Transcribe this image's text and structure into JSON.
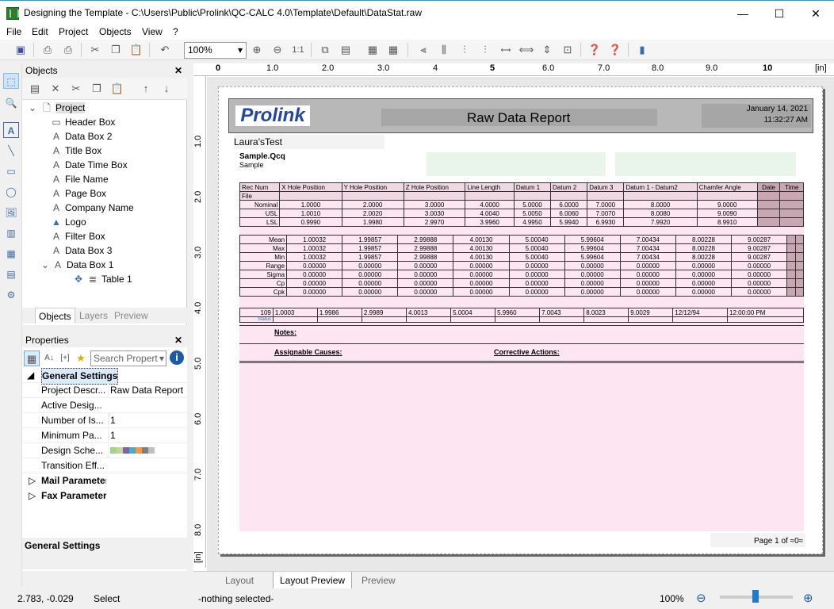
{
  "window": {
    "title": "Designing the Template - C:\\Users\\Public\\Prolink\\QC-CALC 4.0\\Template\\Default\\DataStat.raw"
  },
  "menu": [
    "File",
    "Edit",
    "Project",
    "Objects",
    "View",
    "?"
  ],
  "toolbar": {
    "zoom_value": "100%"
  },
  "objects_panel": {
    "title": "Objects",
    "tree": [
      {
        "label": "Project",
        "icon": "page-icon",
        "level": 0
      },
      {
        "label": "Header Box",
        "icon": "rect-icon",
        "level": 1
      },
      {
        "label": "Data Box 2",
        "icon": "text-icon",
        "level": 1
      },
      {
        "label": "Title Box",
        "icon": "text-icon",
        "level": 1
      },
      {
        "label": "Date Time Box",
        "icon": "text-icon",
        "level": 1
      },
      {
        "label": "File Name",
        "icon": "text-icon",
        "level": 1
      },
      {
        "label": "Page Box",
        "icon": "text-icon",
        "level": 1
      },
      {
        "label": "Company Name",
        "icon": "text-icon",
        "level": 1
      },
      {
        "label": "Logo",
        "icon": "image-icon",
        "level": 1
      },
      {
        "label": "Filter Box",
        "icon": "text-icon",
        "level": 1
      },
      {
        "label": "Data Box 3",
        "icon": "text-icon",
        "level": 1
      },
      {
        "label": "Data Box 1",
        "icon": "text-icon",
        "level": 1
      },
      {
        "label": "Table 1",
        "icon": "table-icon",
        "level": 2
      }
    ],
    "tabs": [
      "Objects",
      "Layers",
      "Preview"
    ]
  },
  "properties_panel": {
    "title": "Properties",
    "search_placeholder": "Search Propert",
    "group": "General Settings",
    "rows": [
      {
        "name": "Project Descr...",
        "value": "Raw Data Report"
      },
      {
        "name": "Active Desig...",
        "value": ""
      },
      {
        "name": "Number of Is...",
        "value": "1"
      },
      {
        "name": "Minimum Pa...",
        "value": "1"
      },
      {
        "name": "Design Sche...",
        "value": ""
      },
      {
        "name": "Transition Eff...",
        "value": ""
      }
    ],
    "collapsed": [
      "Mail Parameter",
      "Fax Parameter"
    ],
    "footer": "General Settings"
  },
  "ruler": {
    "h": [
      "0",
      "1.0",
      "2.0",
      "3.0",
      "4",
      "5",
      "6.0",
      "7.0",
      "8.0",
      "9.0",
      "10",
      "[in]"
    ],
    "v": [
      "1.0",
      "2.0",
      "3.0",
      "4.0",
      "5.0",
      "6.0",
      "7.0",
      "8.0",
      "[in]"
    ]
  },
  "report": {
    "logo": "Prolink",
    "title": "Raw Data Report",
    "date": "January 14, 2021",
    "time": "11:32:27 AM",
    "company": "Laura'sTest",
    "filter_title": "Sample.Qcq",
    "filter_sub": "Sample",
    "headers": [
      "Rec Num",
      "X Hole Position",
      "Y Hole Position",
      "Z Hole Position",
      "Line Length",
      "Datum 1",
      "Datum 2",
      "Datum 3",
      "Datum 1 - Datum2",
      "Chamfer Angle",
      "Date",
      "Time"
    ],
    "header_sub": "File",
    "limits": [
      [
        "Nominal",
        "1.0000",
        "2.0000",
        "3.0000",
        "4.0000",
        "5.0000",
        "6.0000",
        "7.0000",
        "8.0000",
        "9.0000"
      ],
      [
        "USL",
        "1.0010",
        "2.0020",
        "3.0030",
        "4.0040",
        "5.0050",
        "6.0060",
        "7.0070",
        "8.0080",
        "9.0090"
      ],
      [
        "LSL",
        "0.9990",
        "1.9980",
        "2.9970",
        "3.9960",
        "4.9950",
        "5.9940",
        "6.9930",
        "7.9920",
        "8.9910"
      ]
    ],
    "stats": [
      [
        "Mean",
        "1.00032",
        "1.99857",
        "2.99888",
        "4.00130",
        "5.00040",
        "5.99604",
        "7.00434",
        "8.00228",
        "9.00287"
      ],
      [
        "Max",
        "1.00032",
        "1.99857",
        "2.99888",
        "4.00130",
        "5.00040",
        "5.99604",
        "7.00434",
        "8.00228",
        "9.00287"
      ],
      [
        "Min",
        "1.00032",
        "1.99857",
        "2.99888",
        "4.00130",
        "5.00040",
        "5.99604",
        "7.00434",
        "8.00228",
        "9.00287"
      ],
      [
        "Range",
        "0.00000",
        "0.00000",
        "0.00000",
        "0.00000",
        "0.00000",
        "0.00000",
        "0.00000",
        "0.00000",
        "0.00000"
      ],
      [
        "Sigma",
        "0.00000",
        "0.00000",
        "0.00000",
        "0.00000",
        "0.00000",
        "0.00000",
        "0.00000",
        "0.00000",
        "0.00000"
      ],
      [
        "Cp",
        "0.00000",
        "0.00000",
        "0.00000",
        "0.00000",
        "0.00000",
        "0.00000",
        "0.00000",
        "0.00000",
        "0.00000"
      ],
      [
        "Cpk",
        "0.00000",
        "0.00000",
        "0.00000",
        "0.00000",
        "0.00000",
        "0.00000",
        "0.00000",
        "0.00000",
        "0.00000"
      ]
    ],
    "datarow": [
      "109",
      "1.0003",
      "1.9986",
      "2.9989",
      "4.0013",
      "5.0004",
      "5.9960",
      "7.0043",
      "8.0023",
      "9.0029",
      "12/12/94",
      "12:00:00 PM"
    ],
    "datarow_sub": "Status",
    "notes": "Notes:",
    "assignable": "Assignable Causes:",
    "corrective": "Corrective Actions:",
    "page": "Page 1 of ≈0≈"
  },
  "layout_tabs": [
    "Layout",
    "Layout Preview",
    "Preview"
  ],
  "status": {
    "coords": "2.783, -0.029",
    "mode": "Select",
    "selection": "-nothing selected-",
    "zoom": "100%"
  },
  "colors": {
    "header_bg": "#b8b8b8",
    "stat_col": "#c8a7b3",
    "pink": "#fde6f1",
    "logo": "#2446a2"
  }
}
